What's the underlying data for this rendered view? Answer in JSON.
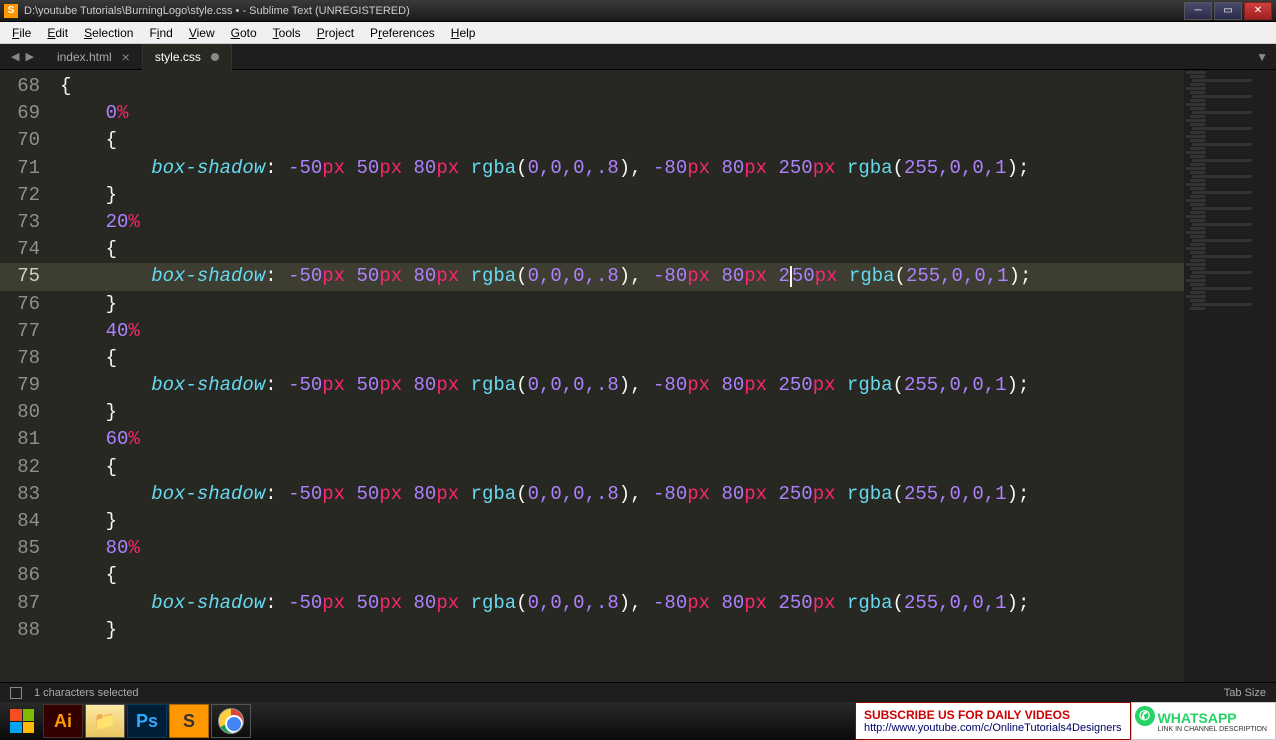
{
  "window": {
    "title": "D:\\youtube Tutorials\\BurningLogo\\style.css • - Sublime Text (UNREGISTERED)",
    "icon_letter": "S"
  },
  "menu": {
    "file": "File",
    "edit": "Edit",
    "selection": "Selection",
    "find": "Find",
    "view": "View",
    "goto": "Goto",
    "tools": "Tools",
    "project": "Project",
    "preferences": "Preferences",
    "help": "Help"
  },
  "tabs": {
    "tab1": "index.html",
    "tab2": "style.css"
  },
  "code": {
    "lines": [
      {
        "n": "68",
        "indent": 0,
        "type": "brace",
        "text": "{"
      },
      {
        "n": "69",
        "indent": 1,
        "type": "pct",
        "val": "0",
        "pct": "%"
      },
      {
        "n": "70",
        "indent": 1,
        "type": "brace",
        "text": "{"
      },
      {
        "n": "71",
        "indent": 2,
        "type": "shadow"
      },
      {
        "n": "72",
        "indent": 1,
        "type": "brace",
        "text": "}"
      },
      {
        "n": "73",
        "indent": 1,
        "type": "pct",
        "val": "20",
        "pct": "%"
      },
      {
        "n": "74",
        "indent": 1,
        "type": "brace",
        "text": "{"
      },
      {
        "n": "75",
        "indent": 2,
        "type": "shadow",
        "active": true,
        "caret": true
      },
      {
        "n": "76",
        "indent": 1,
        "type": "brace",
        "text": "}"
      },
      {
        "n": "77",
        "indent": 1,
        "type": "pct",
        "val": "40",
        "pct": "%"
      },
      {
        "n": "78",
        "indent": 1,
        "type": "brace",
        "text": "{"
      },
      {
        "n": "79",
        "indent": 2,
        "type": "shadow"
      },
      {
        "n": "80",
        "indent": 1,
        "type": "brace",
        "text": "}"
      },
      {
        "n": "81",
        "indent": 1,
        "type": "pct",
        "val": "60",
        "pct": "%"
      },
      {
        "n": "82",
        "indent": 1,
        "type": "brace",
        "text": "{"
      },
      {
        "n": "83",
        "indent": 2,
        "type": "shadow"
      },
      {
        "n": "84",
        "indent": 1,
        "type": "brace",
        "text": "}"
      },
      {
        "n": "85",
        "indent": 1,
        "type": "pct",
        "val": "80",
        "pct": "%"
      },
      {
        "n": "86",
        "indent": 1,
        "type": "brace",
        "text": "{"
      },
      {
        "n": "87",
        "indent": 2,
        "type": "shadow"
      },
      {
        "n": "88",
        "indent": 1,
        "type": "brace",
        "text": "}"
      }
    ],
    "shadow": {
      "prop": "box-shadow",
      "v1": "-50",
      "v2": "50",
      "v3": "80",
      "rgba1_fn": "rgba",
      "rgba1_args": "0,0,0,.8",
      "v4": "-80",
      "v5": "80",
      "v6a": "2",
      "v6b": "50",
      "rgba2_fn": "rgba",
      "rgba2_args": "255,0,0,1",
      "px": "px"
    }
  },
  "status": {
    "selection": "1 characters selected",
    "tabsize": "Tab Size"
  },
  "banner": {
    "subscribe": "SUBSCRIBE US FOR DAILY VIDEOS",
    "url": "http://www.youtube.com/c/OnlineTutorials4Designers",
    "whatsapp": "WHATSAPP",
    "whatsapp_sub": "LINK IN CHANNEL DESCRIPTION"
  }
}
